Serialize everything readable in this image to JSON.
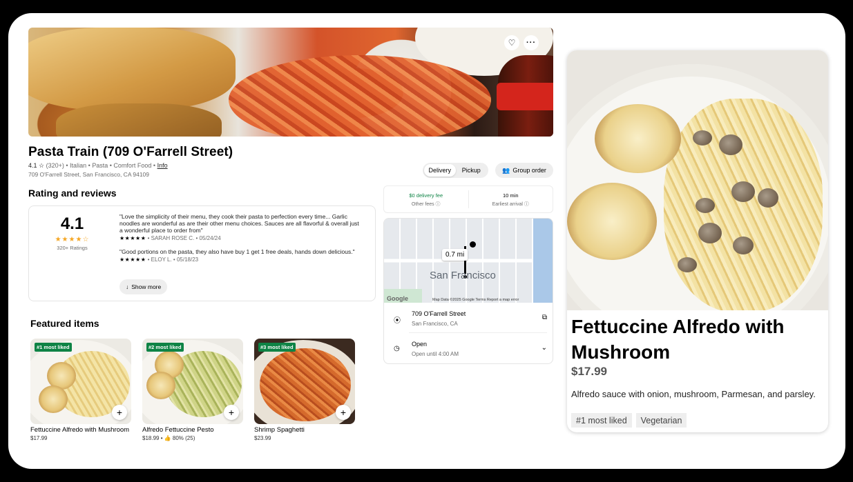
{
  "store": {
    "name": "Pasta Train (709 O'Farrell Street)",
    "rating": "4.1 ☆",
    "rating_count": "(320+)",
    "tags": "• Italian • Pasta • Comfort Food •",
    "info_link": "Info",
    "address": "709 O'Farrell Street, San Francisco, CA 94109"
  },
  "mode": {
    "delivery": "Delivery",
    "pickup": "Pickup",
    "selected": "Delivery"
  },
  "group_order": "Group order",
  "reviews": {
    "heading": "Rating and reviews",
    "score": "4.1",
    "stars": "★★★★☆",
    "count": "320+ Ratings",
    "items": [
      {
        "text": "\"Love the simplicity of their menu, they cook their pasta to perfection every time... Garlic noodles are wonderful as are their other menu choices. Sauces are all flavorful & overall just a wonderful place to order from\"",
        "stars": "★★★★★",
        "byline": "• SARAH ROSE C. • 05/24/24"
      },
      {
        "text": "\"Good portions on the pasta, they also have buy 1 get 1 free deals, hands down delicious.\"",
        "stars": "★★★★★",
        "byline": "• ELOY L. • 05/18/23"
      }
    ],
    "show_more": "Show more"
  },
  "fees": {
    "delivery_fee": "$0 delivery fee",
    "other_fees": "Other fees ⓘ",
    "arrival": "10 min",
    "arrival_label": "Earliest arrival ⓘ"
  },
  "map": {
    "distance": "0.7 mi",
    "city": "San Francisco",
    "google": "Google",
    "footer": "Map Data ©2025 Google    Terms    Report a map error"
  },
  "location": {
    "street": "709 O'Farrell Street",
    "city": "San Francisco, CA",
    "status": "Open",
    "hours": "Open until 4:00 AM"
  },
  "featured": {
    "heading": "Featured items",
    "items": [
      {
        "badge": "#1 most liked",
        "name": "Fettuccine Alfredo with Mushroom",
        "price": "$17.99"
      },
      {
        "badge": "#2 most liked",
        "name": "Alfredo Fettuccine Pesto",
        "price": "$18.99 • 👍 80% (25)"
      },
      {
        "badge": "#3 most liked",
        "name": "Shrimp Spaghetti",
        "price": "$23.99"
      }
    ]
  },
  "detail": {
    "name": "Fettuccine Alfredo with Mushroom",
    "price": "$17.99",
    "description": "Alfredo sauce with onion, mushroom, Parmesan, and parsley.",
    "tags": [
      "#1 most liked",
      "Vegetarian"
    ]
  },
  "colors": {
    "accent_green": "#0e8345",
    "star": "#f5a623"
  }
}
